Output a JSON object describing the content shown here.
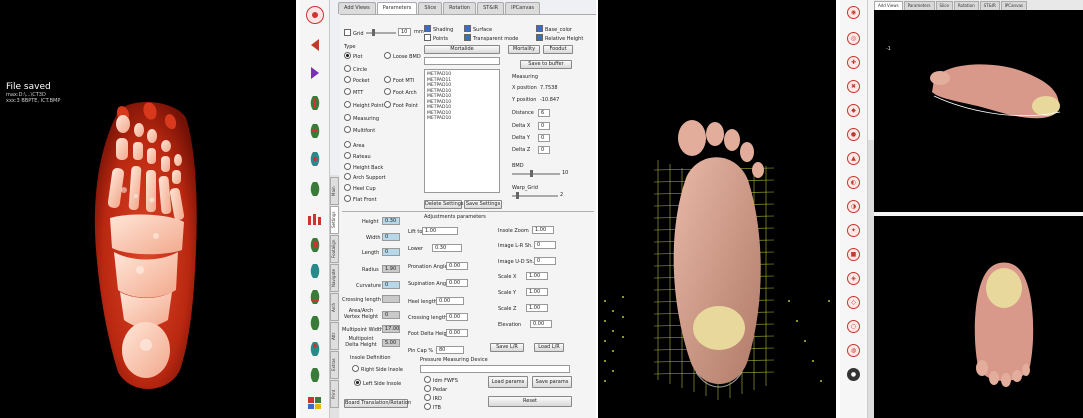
{
  "panel1": {
    "status": "File saved",
    "path_lines": [
      "max:D:\\...\\CT3D",
      "xxx:3 BBPTE, ICT.BMP"
    ]
  },
  "panel2": {
    "top_tabs": [
      "Add Views",
      "Parameters",
      "Slice",
      "Rotation",
      "ST&IR",
      "IPCanvas"
    ],
    "grid_label": "Grid",
    "grid_value": "10",
    "grid_unit": "mm",
    "checks": [
      {
        "label": "Shading",
        "on": true
      },
      {
        "label": "Points",
        "on": false
      },
      {
        "label": "Surface",
        "on": true
      },
      {
        "label": "Transparent mode",
        "on": true
      },
      {
        "label": "Base_color",
        "on": true
      },
      {
        "label": "Relative Height",
        "on": true
      }
    ],
    "type_label": "Type",
    "type_options": [
      {
        "label": "Plot",
        "on": true
      },
      {
        "label": "Loose BMD",
        "on": false
      },
      {
        "label": "Circle",
        "on": false
      },
      {
        "label": "Pocket",
        "on": false
      },
      {
        "label": "Foot MTI",
        "on": false
      },
      {
        "label": "MTT",
        "on": false
      },
      {
        "label": "Foot Arch",
        "on": false
      },
      {
        "label": "Height Point",
        "on": false
      },
      {
        "label": "Foot Point",
        "on": false
      },
      {
        "label": "Measuring",
        "on": false
      },
      {
        "label": "Multifont",
        "on": false
      },
      {
        "label": "Area",
        "on": false
      },
      {
        "label": "Rateau",
        "on": false
      },
      {
        "label": "Height Back",
        "on": false
      },
      {
        "label": "Arch Support",
        "on": false
      },
      {
        "label": "Heel Cup",
        "on": false
      },
      {
        "label": "Flat Front",
        "on": false
      }
    ],
    "buttons_top": [
      "Mortalide",
      "Mortality",
      "Foodut"
    ],
    "save_to_buffer": "Save to buffer",
    "list_items": [
      "METPAD10",
      "METPAD11",
      "METPAD10",
      "METPAD10",
      "METPAD10",
      "METPAD10",
      "METPAD10",
      "METPAD10",
      "METPAD10"
    ],
    "measuring_label": "Measuring",
    "measure_rows": [
      {
        "label": "X position",
        "value": "7.7538"
      },
      {
        "label": "Y position",
        "value": "-10.847"
      },
      {
        "label": "Distance",
        "value": "6"
      },
      {
        "label": "Delta X",
        "value": "0"
      },
      {
        "label": "Delta Y",
        "value": "0"
      },
      {
        "label": "Delta Z",
        "value": "0"
      }
    ],
    "bmd_label": "BMD",
    "bmd_value": "10",
    "warp_label": "Warp_Grid",
    "warp_value": "2",
    "delete_settings": "Delete Settings",
    "save_settings": "Save Settings",
    "adjust_label": "Adjustments parameters",
    "left_params": [
      {
        "label": "Height",
        "value": "0.30",
        "style": "blue"
      },
      {
        "label": "Width",
        "value": "0",
        "style": "blue"
      },
      {
        "label": "Length",
        "value": "0",
        "style": "blue"
      },
      {
        "label": "Radius",
        "value": "1.90",
        "style": "gray"
      },
      {
        "label": "Curvature",
        "value": "0",
        "style": "blue"
      },
      {
        "label": "Crossing length",
        "value": "",
        "style": "gray"
      },
      {
        "label": "Area/Arch Vertex Height",
        "value": "0",
        "style": "gray"
      },
      {
        "label": "Multipoint Width",
        "value": "17.00",
        "style": "gray"
      },
      {
        "label": "Multipoint Delta Height",
        "value": "5.00",
        "style": "gray"
      }
    ],
    "mid_params": [
      {
        "label": "Lift to",
        "value": "1.00"
      },
      {
        "label": "Lower",
        "value": "0.30"
      },
      {
        "label": "Pronation Angle",
        "value": "0.00"
      },
      {
        "label": "Supination Angle",
        "value": "0.00"
      },
      {
        "label": "Heel length",
        "value": "0.00"
      },
      {
        "label": "Crossing length",
        "value": "0.00"
      },
      {
        "label": "Foot Delta Height",
        "value": "0.00"
      },
      {
        "label": "Pin Cap %",
        "value": "80"
      }
    ],
    "right_params": [
      {
        "label": "Insole Zoom",
        "value": "1.00"
      },
      {
        "label": "Image L-R Sh.",
        "value": "0"
      },
      {
        "label": "Image U-D Sh.",
        "value": "0"
      },
      {
        "label": "Scale X",
        "value": "1.00"
      },
      {
        "label": "Scale Y",
        "value": "1.00"
      },
      {
        "label": "Scale Z",
        "value": "1.00"
      },
      {
        "label": "Elevation",
        "value": "0.00"
      }
    ],
    "save_lr": "Save L/R",
    "load_lr": "Load L/R",
    "insole_def": "Insole Definition",
    "right_insole": "Right Side Insole",
    "left_insole": "Left Side Insole",
    "board_btn": "Board Translation/Rotation",
    "pressure_label": "Pressure Measuring Device",
    "pressure_opts": [
      "Idm FWFS",
      "Pedar",
      "IRD",
      "ITB"
    ],
    "load_params": "Load params",
    "save_params": "Save params",
    "reset": "Reset",
    "vtabs": [
      "Main",
      "Settings",
      "Footalign",
      "Navigate",
      "Arch",
      "Attr",
      "Extras",
      "Print"
    ]
  },
  "panel4": {
    "tabs": [
      "Add Views",
      "Parameters",
      "Slice",
      "Rotation",
      "ST&IR",
      "IPCanvas"
    ],
    "marker": "-1"
  }
}
